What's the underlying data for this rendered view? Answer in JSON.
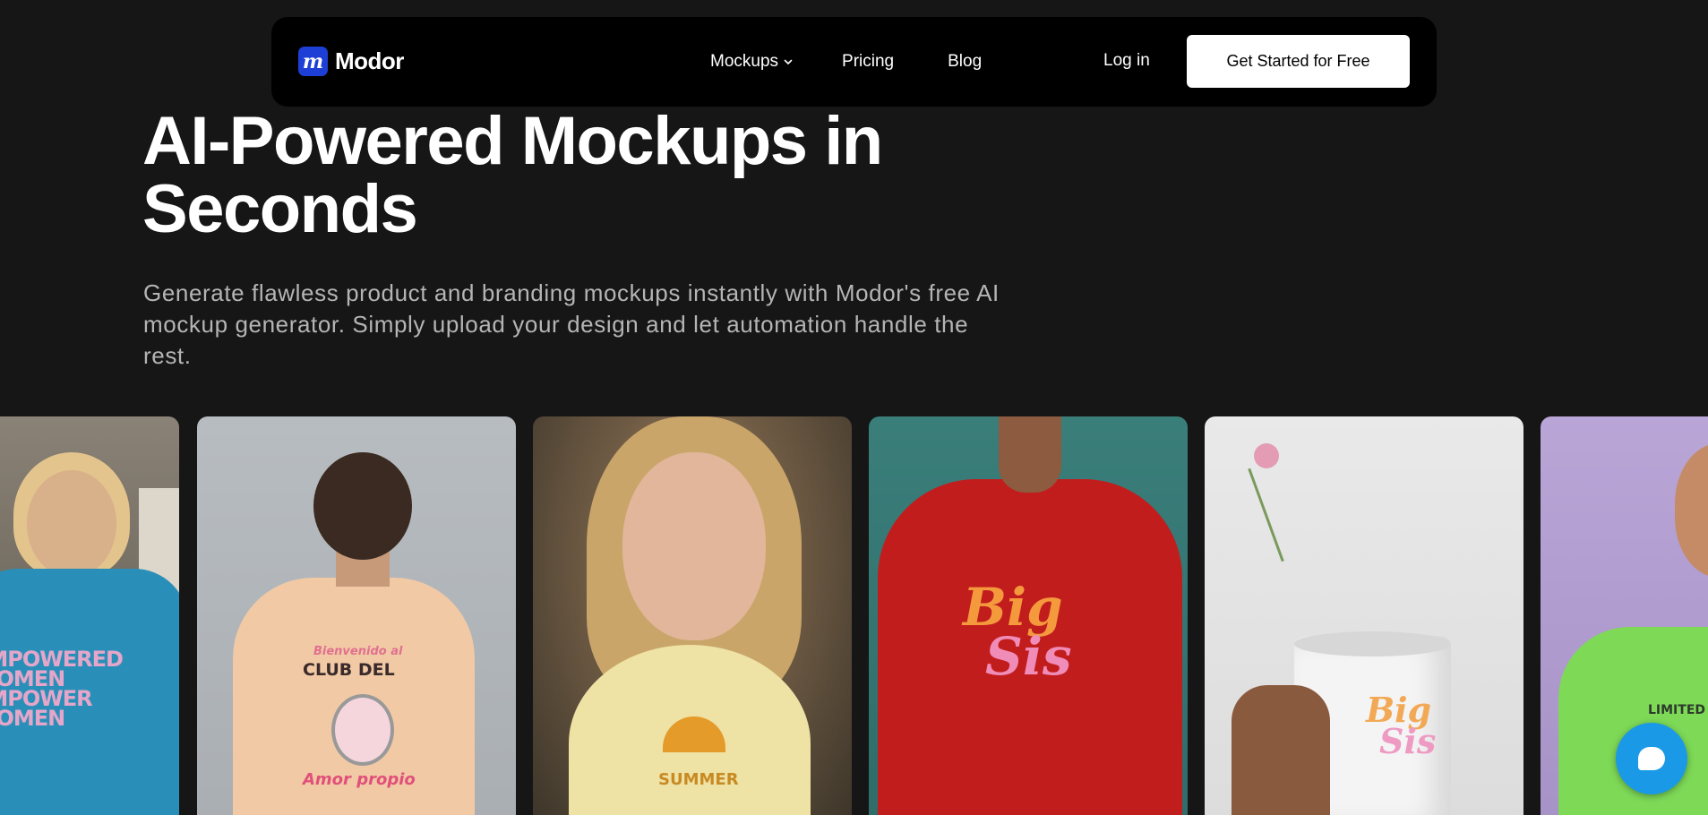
{
  "nav": {
    "logo_mark": "m",
    "logo_text": "Modor",
    "links": [
      {
        "label": "Mockups",
        "has_dropdown": true
      },
      {
        "label": "Pricing"
      },
      {
        "label": "Blog"
      }
    ],
    "login_label": "Log in",
    "cta_label": "Get Started for Free"
  },
  "hero": {
    "title": "AI-Powered Mockups in Seconds",
    "subtitle": "Generate flawless product and branding mockups instantly with Modor's free AI mockup generator. Simply upload your design and let automation handle the rest."
  },
  "cards": {
    "c0": {
      "print": "EMPOWERED WOMEN EMPOWER WOMEN"
    },
    "c1": {
      "print_top": "Bienvenido al",
      "print_main": "CLUB DEL",
      "print_bottom": "Amor propio"
    },
    "c2": {
      "print": "SUMMER"
    },
    "c3": {
      "print_line1": "Big",
      "print_line2": "Sis"
    },
    "c4": {
      "print_line1": "Big",
      "print_line2": "Sis"
    },
    "c5": {
      "print": "LIMITED"
    }
  },
  "colors": {
    "background": "#161616",
    "nav_background": "#000000",
    "logo_accent": "#1d3fd6",
    "chat_button": "#1a9ae6"
  },
  "icons": {
    "dropdown": "chevron-down-icon",
    "chat": "chat-bubble-icon"
  }
}
